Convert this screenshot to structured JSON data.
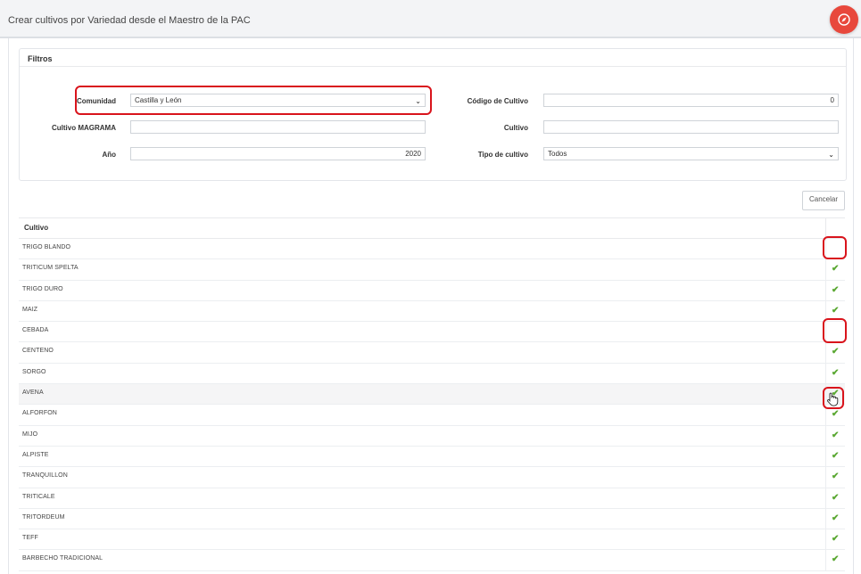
{
  "header": {
    "title": "Crear cultivos por Variedad desde el Maestro de la PAC",
    "fab_icon": "compass-icon",
    "fab_color": "#e8483c"
  },
  "filters": {
    "title": "Filtros",
    "comunidad": {
      "label": "Comunidad",
      "value": "Castilla y León"
    },
    "codigo_cultivo": {
      "label": "Código de Cultivo",
      "value": "0"
    },
    "cultivo_magrama": {
      "label": "Cultivo MAGRAMA",
      "value": ""
    },
    "cultivo": {
      "label": "Cultivo",
      "value": ""
    },
    "anio": {
      "label": "Año",
      "value": "2020"
    },
    "tipo_cultivo": {
      "label": "Tipo de cultivo",
      "value": "Todos"
    }
  },
  "actions": {
    "cancel_label": "Cancelar"
  },
  "table": {
    "header": "Cultivo",
    "check_color": "#5aa832",
    "rows": [
      {
        "name": "TRIGO BLANDO",
        "checked": false
      },
      {
        "name": "TRITICUM SPELTA",
        "checked": true
      },
      {
        "name": "TRIGO DURO",
        "checked": true
      },
      {
        "name": "MAIZ",
        "checked": true
      },
      {
        "name": "CEBADA",
        "checked": false
      },
      {
        "name": "CENTENO",
        "checked": true
      },
      {
        "name": "SORGO",
        "checked": true
      },
      {
        "name": "AVENA",
        "checked": true
      },
      {
        "name": "ALFORFON",
        "checked": true
      },
      {
        "name": "MIJO",
        "checked": true
      },
      {
        "name": "ALPISTE",
        "checked": true
      },
      {
        "name": "TRANQUILLON",
        "checked": true
      },
      {
        "name": "TRITICALE",
        "checked": true
      },
      {
        "name": "TRITORDEUM",
        "checked": true
      },
      {
        "name": "TEFF",
        "checked": true
      },
      {
        "name": "BARBECHO TRADICIONAL",
        "checked": true
      }
    ]
  }
}
